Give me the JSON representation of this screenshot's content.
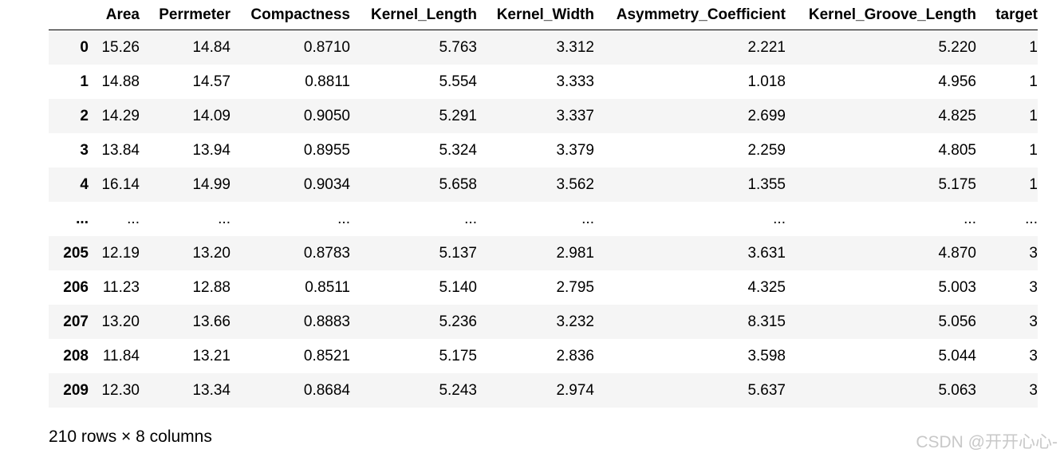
{
  "table": {
    "columns": [
      "Area",
      "Perrmeter",
      "Compactness",
      "Kernel_Length",
      "Kernel_Width",
      "Asymmetry_Coefficient",
      "Kernel_Groove_Length",
      "target"
    ],
    "rows": [
      {
        "index": "0",
        "cells": [
          "15.26",
          "14.84",
          "0.8710",
          "5.763",
          "3.312",
          "2.221",
          "5.220",
          "1"
        ]
      },
      {
        "index": "1",
        "cells": [
          "14.88",
          "14.57",
          "0.8811",
          "5.554",
          "3.333",
          "1.018",
          "4.956",
          "1"
        ]
      },
      {
        "index": "2",
        "cells": [
          "14.29",
          "14.09",
          "0.9050",
          "5.291",
          "3.337",
          "2.699",
          "4.825",
          "1"
        ]
      },
      {
        "index": "3",
        "cells": [
          "13.84",
          "13.94",
          "0.8955",
          "5.324",
          "3.379",
          "2.259",
          "4.805",
          "1"
        ]
      },
      {
        "index": "4",
        "cells": [
          "16.14",
          "14.99",
          "0.9034",
          "5.658",
          "3.562",
          "1.355",
          "5.175",
          "1"
        ]
      },
      {
        "index": "...",
        "cells": [
          "...",
          "...",
          "...",
          "...",
          "...",
          "...",
          "...",
          "..."
        ]
      },
      {
        "index": "205",
        "cells": [
          "12.19",
          "13.20",
          "0.8783",
          "5.137",
          "2.981",
          "3.631",
          "4.870",
          "3"
        ]
      },
      {
        "index": "206",
        "cells": [
          "11.23",
          "12.88",
          "0.8511",
          "5.140",
          "2.795",
          "4.325",
          "5.003",
          "3"
        ]
      },
      {
        "index": "207",
        "cells": [
          "13.20",
          "13.66",
          "0.8883",
          "5.236",
          "3.232",
          "8.315",
          "5.056",
          "3"
        ]
      },
      {
        "index": "208",
        "cells": [
          "11.84",
          "13.21",
          "0.8521",
          "5.175",
          "2.836",
          "3.598",
          "5.044",
          "3"
        ]
      },
      {
        "index": "209",
        "cells": [
          "12.30",
          "13.34",
          "0.8684",
          "5.243",
          "2.974",
          "5.637",
          "5.063",
          "3"
        ]
      }
    ]
  },
  "footer": {
    "shape_text": "210 rows × 8 columns"
  },
  "watermark": {
    "text": "CSDN @开开心心-"
  }
}
